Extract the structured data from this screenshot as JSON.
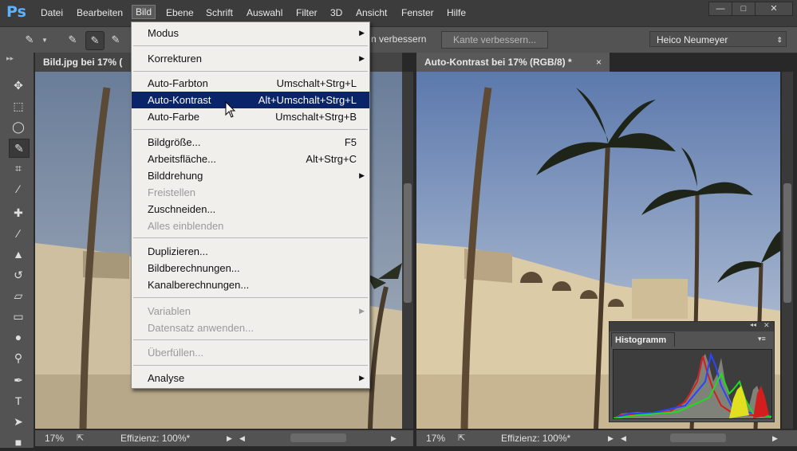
{
  "app": {
    "logo": "Ps"
  },
  "menubar": {
    "items": [
      "Datei",
      "Bearbeiten",
      "Bild",
      "Ebene",
      "Schrift",
      "Auswahl",
      "Filter",
      "3D",
      "Ansicht",
      "Fenster",
      "Hilfe"
    ],
    "active": "Bild"
  },
  "window_controls": {
    "minimize": "—",
    "maximize": "□",
    "close": "✕"
  },
  "options_bar": {
    "refine_text": "n verbessern",
    "refine_edge_button": "Kante verbessern...",
    "workspace": "Heico Neumeyer"
  },
  "documents": [
    {
      "tab": "Bild.jpg bei 17% (",
      "zoom": "17%",
      "efficiency": "Effizienz: 100%*"
    },
    {
      "tab": "Auto-Kontrast bei 17% (RGB/8) *",
      "close": "×",
      "zoom": "17%",
      "efficiency": "Effizienz: 100%*"
    }
  ],
  "bild_menu": {
    "items": [
      {
        "label": "Modus",
        "shortcut": "",
        "submenu": true,
        "disabled": false
      },
      {
        "label": "Korrekturen",
        "shortcut": "",
        "submenu": true,
        "disabled": false
      },
      {
        "label": "Auto-Farbton",
        "shortcut": "Umschalt+Strg+L",
        "submenu": false,
        "disabled": false
      },
      {
        "label": "Auto-Kontrast",
        "shortcut": "Alt+Umschalt+Strg+L",
        "submenu": false,
        "disabled": false,
        "highlighted": true
      },
      {
        "label": "Auto-Farbe",
        "shortcut": "Umschalt+Strg+B",
        "submenu": false,
        "disabled": false
      },
      {
        "label": "Bildgröße...",
        "shortcut": "F5",
        "submenu": false,
        "disabled": false
      },
      {
        "label": "Arbeitsfläche...",
        "shortcut": "Alt+Strg+C",
        "submenu": false,
        "disabled": false
      },
      {
        "label": "Bilddrehung",
        "shortcut": "",
        "submenu": true,
        "disabled": false
      },
      {
        "label": "Freistellen",
        "shortcut": "",
        "submenu": false,
        "disabled": true
      },
      {
        "label": "Zuschneiden...",
        "shortcut": "",
        "submenu": false,
        "disabled": false
      },
      {
        "label": "Alles einblenden",
        "shortcut": "",
        "submenu": false,
        "disabled": true
      },
      {
        "label": "Duplizieren...",
        "shortcut": "",
        "submenu": false,
        "disabled": false
      },
      {
        "label": "Bildberechnungen...",
        "shortcut": "",
        "submenu": false,
        "disabled": false
      },
      {
        "label": "Kanalberechnungen...",
        "shortcut": "",
        "submenu": false,
        "disabled": false
      },
      {
        "label": "Variablen",
        "shortcut": "",
        "submenu": true,
        "disabled": true
      },
      {
        "label": "Datensatz anwenden...",
        "shortcut": "",
        "submenu": false,
        "disabled": true
      },
      {
        "label": "Überfüllen...",
        "shortcut": "",
        "submenu": false,
        "disabled": true
      },
      {
        "label": "Analyse",
        "shortcut": "",
        "submenu": true,
        "disabled": false
      }
    ]
  },
  "histogram_panel": {
    "title": "Histogramm",
    "collapse": "◂◂",
    "close": "✕",
    "menu": "▾≡"
  },
  "colors": {
    "menu_highlight": "#0a246a",
    "ps_blue": "#5eb1ff"
  },
  "icons": [
    "move-icon",
    "marquee-icon",
    "lasso-icon",
    "quick-selection-icon",
    "crop-icon",
    "eyedropper-icon",
    "healing-icon",
    "brush-icon",
    "stamp-icon",
    "history-brush-icon",
    "eraser-icon",
    "gradient-icon",
    "blur-icon",
    "dodge-icon",
    "pen-icon",
    "type-icon",
    "path-selection-icon",
    "shape-icon"
  ]
}
